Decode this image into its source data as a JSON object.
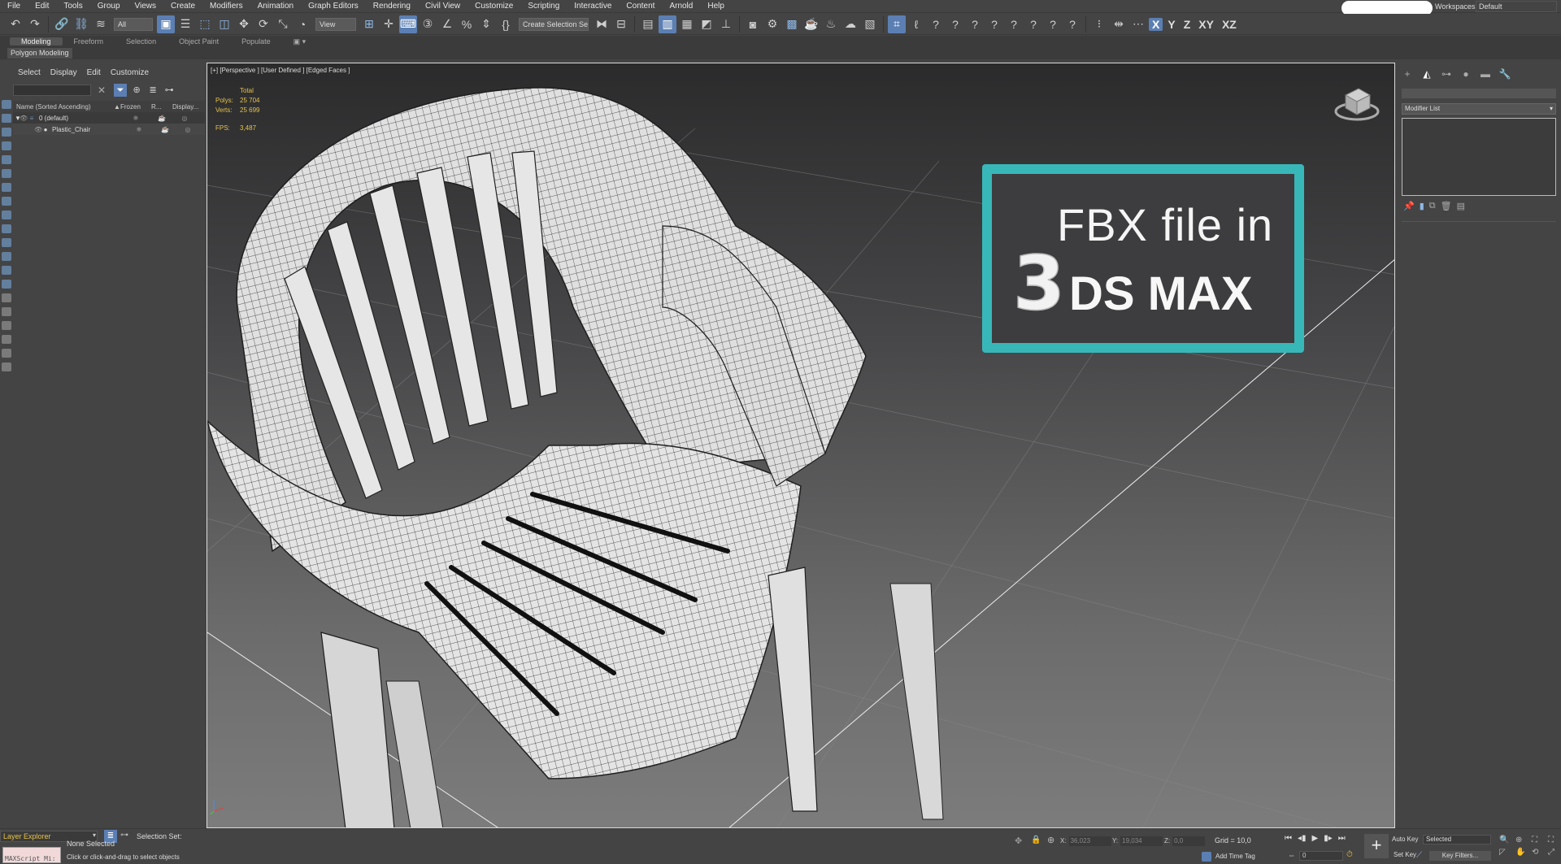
{
  "menu": [
    "File",
    "Edit",
    "Tools",
    "Group",
    "Views",
    "Create",
    "Modifiers",
    "Animation",
    "Graph Editors",
    "Rendering",
    "Civil View",
    "Customize",
    "Scripting",
    "Interactive",
    "Content",
    "Arnold",
    "Help"
  ],
  "workspaces": {
    "label": "Workspaces:",
    "value": "Default"
  },
  "toolbar": {
    "filter_value": "All",
    "ref_coord_value": "View",
    "selection_set_placeholder": "Create Selection Se",
    "axis_x": "X",
    "axis_y": "Y",
    "axis_z": "Z",
    "axis_xy": "XY",
    "axis_xz": "XZ"
  },
  "ribbon": {
    "tabs": [
      "Modeling",
      "Freeform",
      "Selection",
      "Object Paint",
      "Populate"
    ],
    "active_tab": "Modeling",
    "panel_label": "Polygon Modeling"
  },
  "explorer": {
    "menu": [
      "Select",
      "Display",
      "Edit",
      "Customize"
    ],
    "columns": {
      "name": "Name (Sorted Ascending)",
      "frozen": "Frozen",
      "renderable": "R...",
      "display": "Display..."
    },
    "rows": [
      {
        "name": "0 (default)"
      },
      {
        "name": "Plastic_Chair"
      }
    ]
  },
  "viewport": {
    "label": "[+] [Perspective ] [User Defined ] [Edged Faces ]",
    "stats": {
      "total_label": "Total",
      "polys_label": "Polys:",
      "polys": "25 704",
      "verts_label": "Verts:",
      "verts": "25 699",
      "fps_label": "FPS:",
      "fps": "3,487"
    }
  },
  "banner": {
    "line1": "FBX file in",
    "logo_digit": "3",
    "line2": "DS MAX",
    "border_color": "#38b7b9"
  },
  "command_panel": {
    "modifier_list": "Modifier List"
  },
  "status": {
    "layer_explorer": "Layer Explorer",
    "selection_set_label": "Selection Set:",
    "maxscript": "MAXScript Mi:",
    "selection": "None Selected",
    "prompt": "Click or click-and-drag to select objects",
    "x_label": "X:",
    "x_value": "36,023",
    "y_label": "Y:",
    "y_value": "19,034",
    "z_label": "Z:",
    "z_value": "0,0",
    "grid": "Grid = 10,0",
    "add_time_tag": "Add Time Tag",
    "frame": "0",
    "auto_key": "Auto Key",
    "selected": "Selected",
    "set_key": "Set Key",
    "key_filters": "Key Filters..."
  }
}
